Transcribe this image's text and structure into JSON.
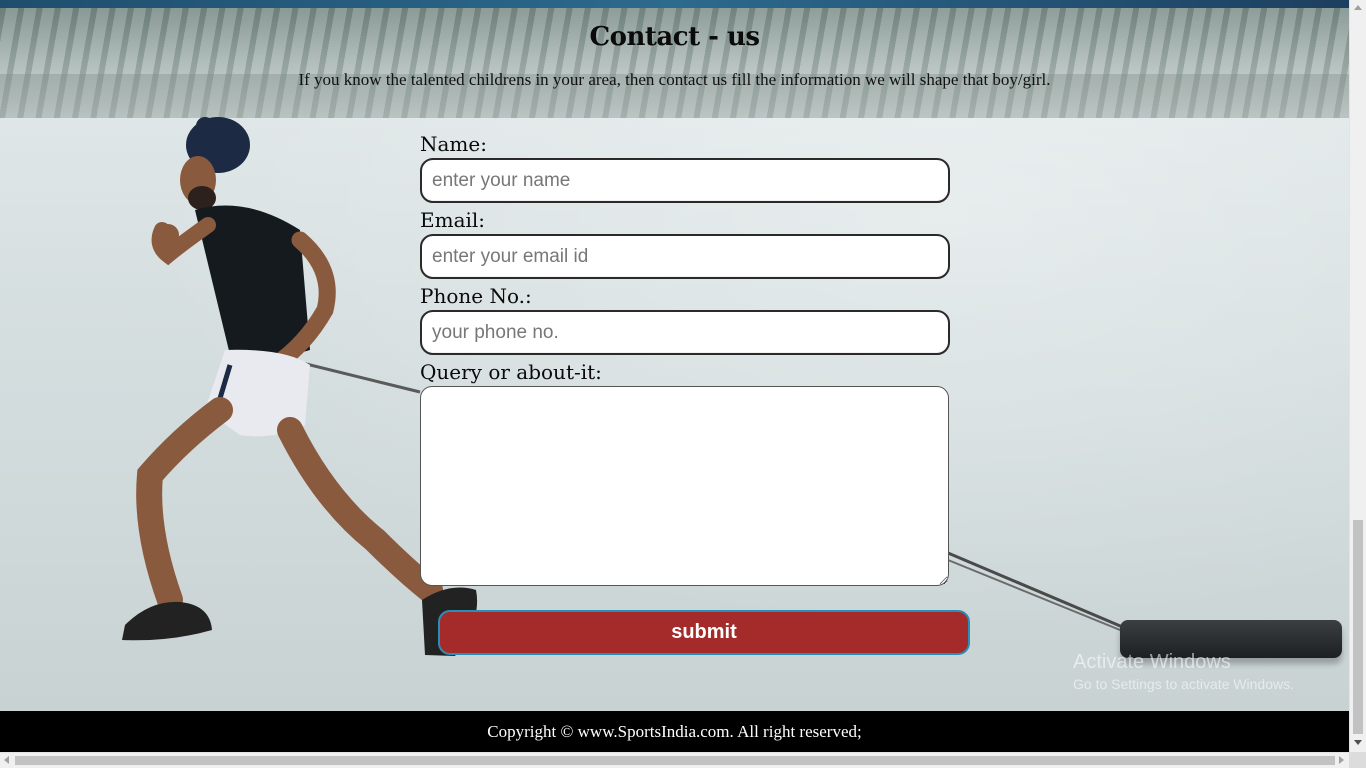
{
  "page": {
    "title": "Contact - us",
    "intro": "If you know the talented childrens in your area, then contact us fill the information we will shape that boy/girl."
  },
  "form": {
    "name_label": "Name:",
    "name_placeholder": "enter your name",
    "email_label": "Email:",
    "email_placeholder": "enter your email id",
    "phone_label": "Phone No.:",
    "phone_placeholder": "your phone no.",
    "query_label": "Query or about-it:",
    "submit_label": "submit"
  },
  "footer": {
    "copyright": "Copyright © www.SportsIndia.com. All right reserved;"
  },
  "watermark": {
    "line1": "Activate Windows",
    "line2": "Go to Settings to activate Windows."
  },
  "colors": {
    "submit_bg": "#a52a2a",
    "submit_border": "#2a8fb8",
    "footer_bg": "#000000"
  },
  "icons": {
    "scroll_up": "scroll-up-arrow-icon",
    "scroll_down": "scroll-down-arrow-icon",
    "scroll_left": "scroll-left-arrow-icon",
    "scroll_right": "scroll-right-arrow-icon"
  }
}
